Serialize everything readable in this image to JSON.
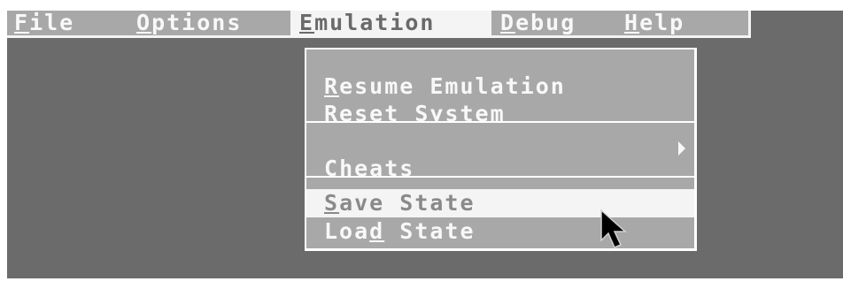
{
  "menubar": {
    "items": [
      {
        "label": "File",
        "accelerator": "F"
      },
      {
        "label": "Options",
        "accelerator": "O"
      },
      {
        "label": "Emulation",
        "accelerator": "E"
      },
      {
        "label": "Debug",
        "accelerator": "D"
      },
      {
        "label": "Help",
        "accelerator": "H"
      }
    ],
    "active_item": "Emulation"
  },
  "emulation_menu": {
    "resume": {
      "before": "",
      "accel": "R",
      "after": "esume Emulation"
    },
    "reset": {
      "before": "Rese",
      "accel": "t",
      "after": " System"
    },
    "cheats": {
      "before": "",
      "accel": "C",
      "after": "heats",
      "has_submenu": true
    },
    "save_state": {
      "before": "",
      "accel": "S",
      "after": "ave State",
      "highlighted": true
    },
    "load_state": {
      "before": "Loa",
      "accel": "d",
      "after": " State"
    }
  },
  "colors": {
    "desktop": "#6b6b6b",
    "menu_background": "#a8a8a8",
    "highlight": "#f4f4f4",
    "text": "#f8f8f8"
  }
}
